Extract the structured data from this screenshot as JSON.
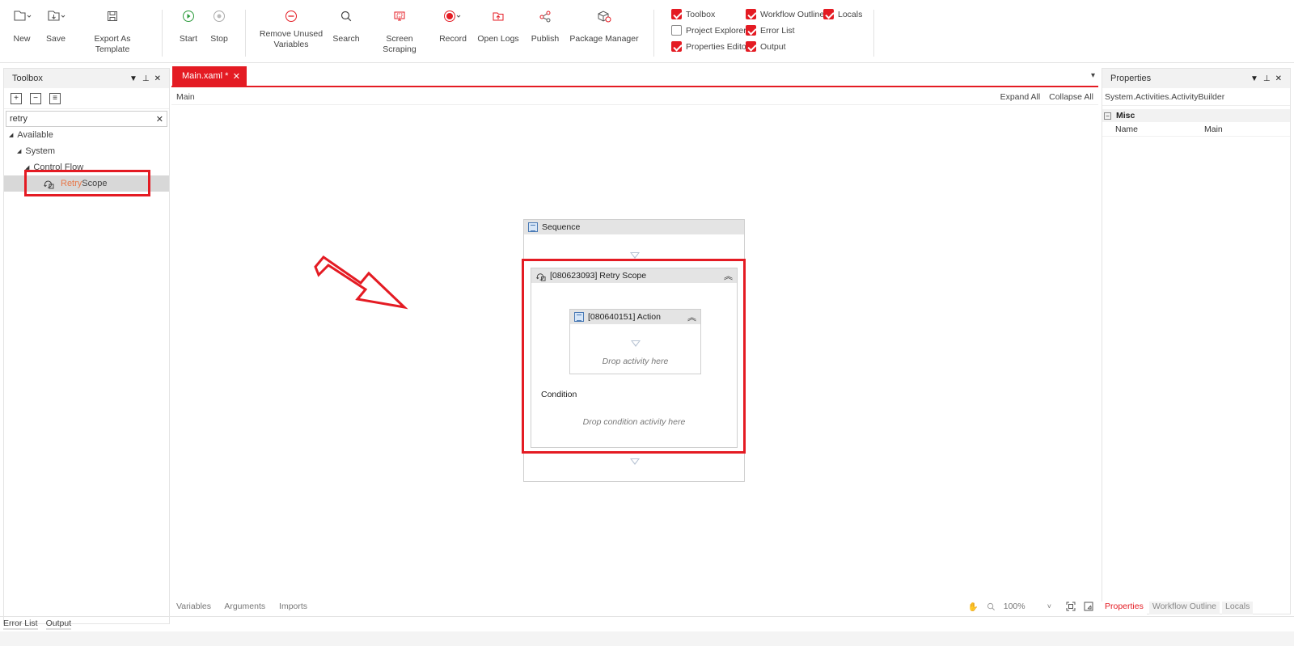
{
  "ribbon": {
    "new_label": "New",
    "save_label": "Save",
    "export_label": "Export As Template",
    "start_label": "Start",
    "stop_label": "Stop",
    "remove_unused_line1": "Remove Unused",
    "remove_unused_line2": "Variables",
    "search_label": "Search",
    "screen_scraping_label": "Screen Scraping",
    "record_label": "Record",
    "open_logs_label": "Open Logs",
    "publish_label": "Publish",
    "package_manager_label": "Package Manager",
    "toggles": {
      "toolbox": "Toolbox",
      "workflow_outline": "Workflow Outline",
      "locals": "Locals",
      "project_explorer": "Project Explorer",
      "error_list": "Error List",
      "properties_editor": "Properties Editor",
      "output": "Output"
    }
  },
  "toolbox": {
    "title": "Toolbox",
    "search_value": "retry",
    "tree": {
      "available": "Available",
      "system": "System",
      "control_flow": "Control Flow",
      "item_match": "Retry",
      "item_rest": " Scope"
    }
  },
  "document": {
    "tab_label": "Main.xaml *",
    "breadcrumb": "Main",
    "expand_all": "Expand All",
    "collapse_all": "Collapse All"
  },
  "workflow": {
    "sequence_title": "Sequence",
    "retry_scope_title": "[080623093] Retry Scope",
    "action_title": "[080640151] Action",
    "drop_activity": "Drop activity here",
    "condition_label": "Condition",
    "drop_condition": "Drop condition activity here"
  },
  "canvas_footer": {
    "variables": "Variables",
    "arguments": "Arguments",
    "imports": "Imports",
    "zoom": "100%"
  },
  "properties": {
    "title": "Properties",
    "type_name": "System.Activities.ActivityBuilder",
    "category": "Misc",
    "rows": [
      {
        "key": "Name",
        "value": "Main"
      }
    ],
    "tabs": [
      "Properties",
      "Workflow Outline",
      "Locals"
    ]
  },
  "bottom_tabs": [
    "Error List",
    "Output"
  ],
  "colors": {
    "accent": "#e41b23",
    "highlight_text": "#e8784a"
  }
}
